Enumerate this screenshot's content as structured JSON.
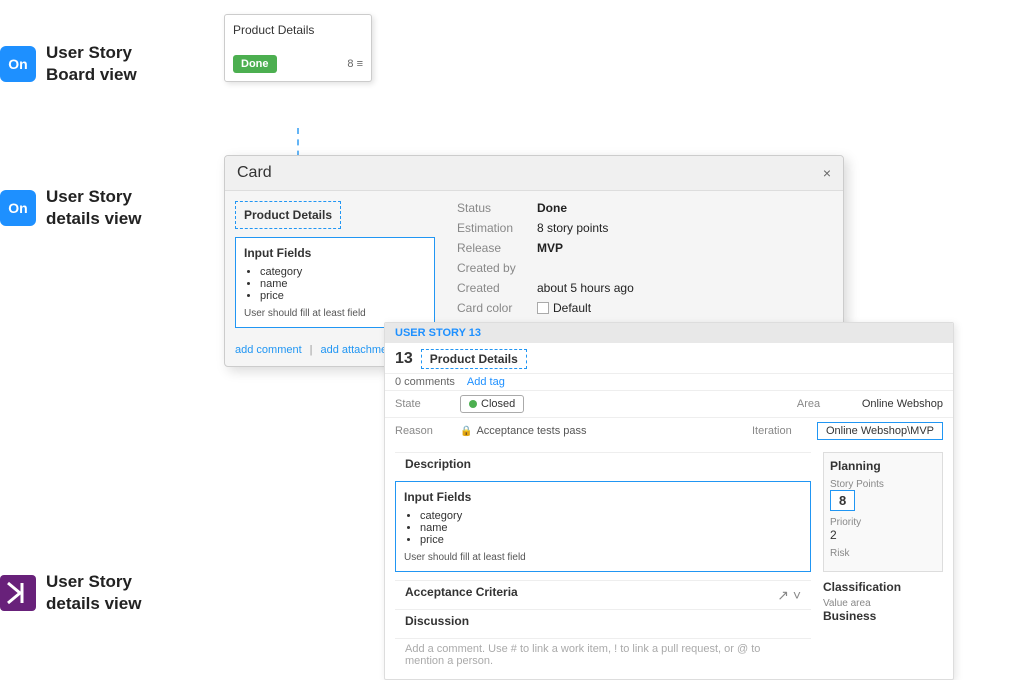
{
  "sidebar": {
    "board_view": {
      "logo": "On",
      "line1": "User Story",
      "line2": "Board view"
    },
    "details_view_top": {
      "logo": "On",
      "line1": "User Story",
      "line2": "details view"
    },
    "details_view_bottom": {
      "logo": "▶|",
      "line1": "User Story",
      "line2": "details view"
    }
  },
  "board_card": {
    "title": "Product Details",
    "badge": "Done",
    "count": "8",
    "list_icon": "≡"
  },
  "main_card": {
    "header_title": "Card",
    "close_label": "×",
    "product_details_label": "Product Details",
    "input_fields": {
      "title": "Input Fields",
      "items": [
        "category",
        "name",
        "price"
      ],
      "note": "User should fill at least field"
    },
    "add_comment": "add comment",
    "add_attachment": "add attachment",
    "separator": "|",
    "meta": {
      "status_label": "Status",
      "status_value": "Done",
      "estimation_label": "Estimation",
      "estimation_value": "8 story points",
      "release_label": "Release",
      "release_value": "MVP",
      "created_by_label": "Created by",
      "created_label": "Created",
      "created_value": "about 5 hours ago",
      "card_color_label": "Card color",
      "card_color_value": "Default"
    }
  },
  "story_panel": {
    "header_label": "USER STORY 13",
    "story_number": "13",
    "story_title": "Product Details",
    "comments_label": "0 comments",
    "add_tag_label": "Add tag",
    "state_label": "State",
    "status_value": "Closed",
    "reason_label": "Reason",
    "reason_value": "Acceptance tests pass",
    "area_label": "Area",
    "area_value": "Online Webshop",
    "iteration_label": "Iteration",
    "iteration_value": "Online Webshop\\MVP",
    "description_heading": "Description",
    "input_fields": {
      "title": "Input Fields",
      "items": [
        "category",
        "name",
        "price"
      ],
      "note": "User should fill at least field"
    },
    "acceptance_criteria_heading": "Acceptance Criteria",
    "discussion_heading": "Discussion",
    "discussion_placeholder": "Add a comment. Use # to link a work item, ! to link a pull request, or @ to mention a person.",
    "planning": {
      "title": "Planning",
      "story_points_label": "Story Points",
      "story_points_value": "8",
      "priority_label": "Priority",
      "priority_value": "2",
      "risk_label": "Risk"
    },
    "classification": {
      "title": "Classification",
      "value_area_label": "Value area",
      "value_area_value": "Business"
    }
  },
  "colors": {
    "blue_dashed": "#2196F3",
    "green_badge": "#4caf50",
    "done_green": "#4caf50"
  }
}
